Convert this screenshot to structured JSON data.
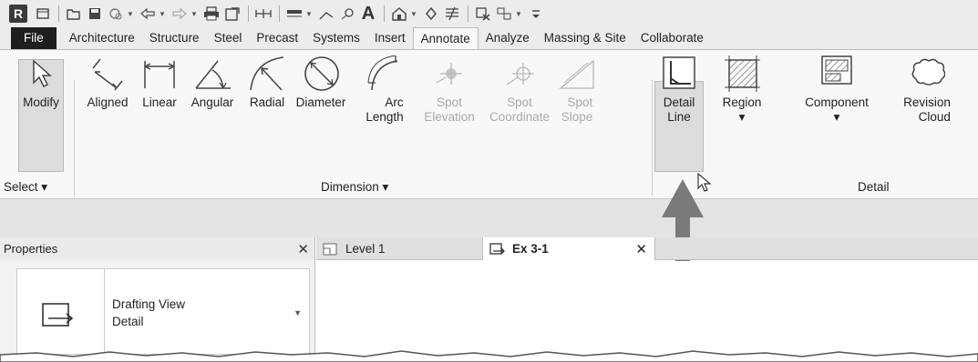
{
  "app": {
    "logo_letter": "R"
  },
  "tabs": [
    "File",
    "Architecture",
    "Structure",
    "Steel",
    "Precast",
    "Systems",
    "Insert",
    "Annotate",
    "Analyze",
    "Massing & Site",
    "Collaborate"
  ],
  "active_tab": "Annotate",
  "ribbon": {
    "select": {
      "tool": "Modify",
      "panel": "Select ▾"
    },
    "dimension": {
      "tools": [
        {
          "label": "Aligned",
          "enabled": true
        },
        {
          "label": "Linear",
          "enabled": true
        },
        {
          "label": "Angular",
          "enabled": true
        },
        {
          "label": "Radial",
          "enabled": true
        },
        {
          "label": "Diameter",
          "enabled": true
        },
        {
          "label": "Arc\nLength",
          "enabled": true
        },
        {
          "label": "Spot\nElevation",
          "enabled": false
        },
        {
          "label": "Spot\nCoordinate",
          "enabled": false
        },
        {
          "label": "Spot\nSlope",
          "enabled": false
        }
      ],
      "panel": "Dimension ▾"
    },
    "detail": {
      "tools": [
        {
          "label": "Detail\nLine"
        },
        {
          "label": "Region\n▾"
        },
        {
          "label": "Component\n▾"
        },
        {
          "label": "Revision\nCloud"
        }
      ],
      "panel": "Detail"
    }
  },
  "properties": {
    "title": "Properties",
    "close": "✕",
    "type_line1": "Drafting View",
    "type_line2": "Detail"
  },
  "doc_tabs": [
    {
      "label": "Level 1"
    },
    {
      "label": "Ex 3-1",
      "active": true,
      "close": "✕"
    }
  ],
  "colors": {
    "file_tab": "#1e1e1e",
    "arrow": "#7a7a7a",
    "highlight": "#dcdcdc"
  }
}
